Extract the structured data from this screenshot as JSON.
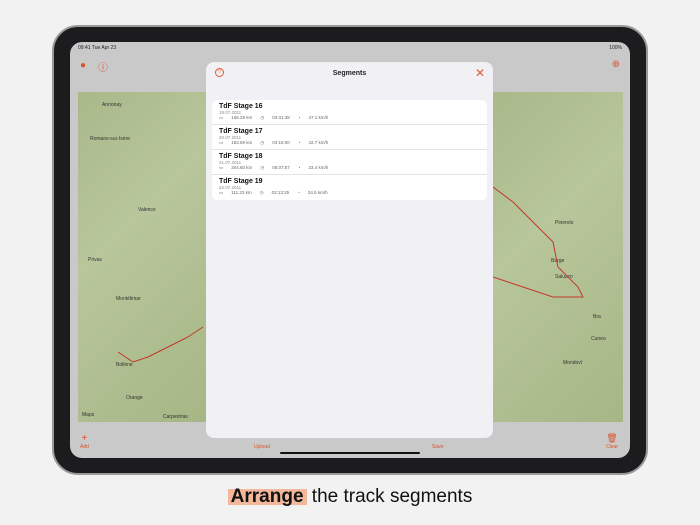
{
  "status": {
    "time": "09:41",
    "date": "Tue Apr 23",
    "battery": "100%"
  },
  "map_left_places": [
    "Valence",
    "Montélimar",
    "Orange",
    "Romans-sur-Isère",
    "Annonay",
    "Privas",
    "Bollène",
    "Carpentras"
  ],
  "map_right_places": [
    "Pinerolo",
    "Cuneo",
    "Saluzzo",
    "Mondovì",
    "Barge",
    "Bra"
  ],
  "map_attribution": "Maps",
  "toolbar": {
    "add": "Add",
    "upload": "Upload",
    "save": "Save",
    "clear": "Clear"
  },
  "modal": {
    "title": "Segments",
    "close_icon": "close-icon",
    "filter_icon": "filter-icon",
    "segments": [
      {
        "name": "TdF Stage 16",
        "date": "19.07.2011",
        "distance": "166.28 km",
        "duration": "03:31:38",
        "speed": "47.1 km/h"
      },
      {
        "name": "TdF Stage 17",
        "date": "20.07.2011",
        "distance": "183.69 km",
        "duration": "04:18:00",
        "speed": "42.7 km/h"
      },
      {
        "name": "TdF Stage 18",
        "date": "21.07.2011",
        "distance": "204.60 km",
        "duration": "06:07:57",
        "speed": "33.4 km/h"
      },
      {
        "name": "TdF Stage 19",
        "date": "22.07.2011",
        "distance": "111.23 km",
        "duration": "03:13:25",
        "speed": "34.5 km/h"
      }
    ]
  },
  "caption": {
    "bold": "Arrange",
    "rest": " the track segments"
  },
  "colors": {
    "accent": "#e05a35"
  }
}
